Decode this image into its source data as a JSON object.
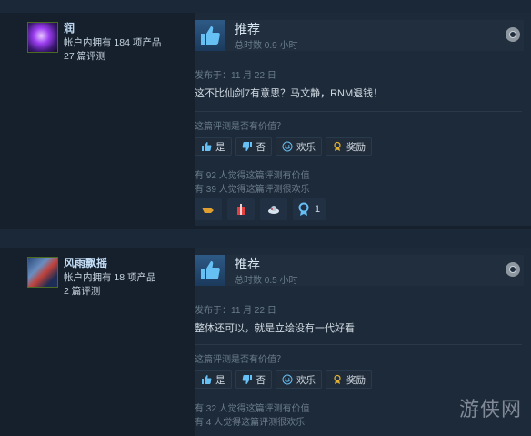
{
  "reviews": [
    {
      "user": {
        "name": "润",
        "products_line": "帐户内拥有 184 项产品",
        "reviews_line": "27 篇评测"
      },
      "verdict": "推荐",
      "hours": "总时数 0.9 小时",
      "posted": "发布于：11 月 22 日",
      "text": "这不比仙剑7有意思？马文静，RNM退钱！",
      "helpful_question": "这篇评测是否有价值？",
      "buttons": {
        "yes": "是",
        "no": "否",
        "funny": "欢乐",
        "award": "奖励"
      },
      "helpful_count_line": "有 92 人觉得这篇评测有价值",
      "funny_count_line": "有 39 人觉得这篇评测很欢乐",
      "awards": [
        {
          "icon": "hand-award-icon",
          "count": ""
        },
        {
          "icon": "gift-award-icon",
          "count": ""
        },
        {
          "icon": "hat-award-icon",
          "count": ""
        },
        {
          "icon": "ribbon-award-icon",
          "count": "1"
        }
      ]
    },
    {
      "user": {
        "name": "风雨飘摇",
        "products_line": "帐户内拥有 18 项产品",
        "reviews_line": "2 篇评测"
      },
      "verdict": "推荐",
      "hours": "总时数 0.5 小时",
      "posted": "发布于：11 月 22 日",
      "text": "整体还可以，就是立绘没有一代好看",
      "helpful_question": "这篇评测是否有价值？",
      "buttons": {
        "yes": "是",
        "no": "否",
        "funny": "欢乐",
        "award": "奖励"
      },
      "helpful_count_line": "有 32 人觉得这篇评测有价值",
      "funny_count_line": "有 4 人觉得这篇评测很欢乐"
    }
  ],
  "watermark": "游侠网",
  "colors": {
    "background": "#1b2838",
    "panel": "#1d2a39",
    "accent_blue": "#66c0f4",
    "award_gold": "#e1b033"
  }
}
